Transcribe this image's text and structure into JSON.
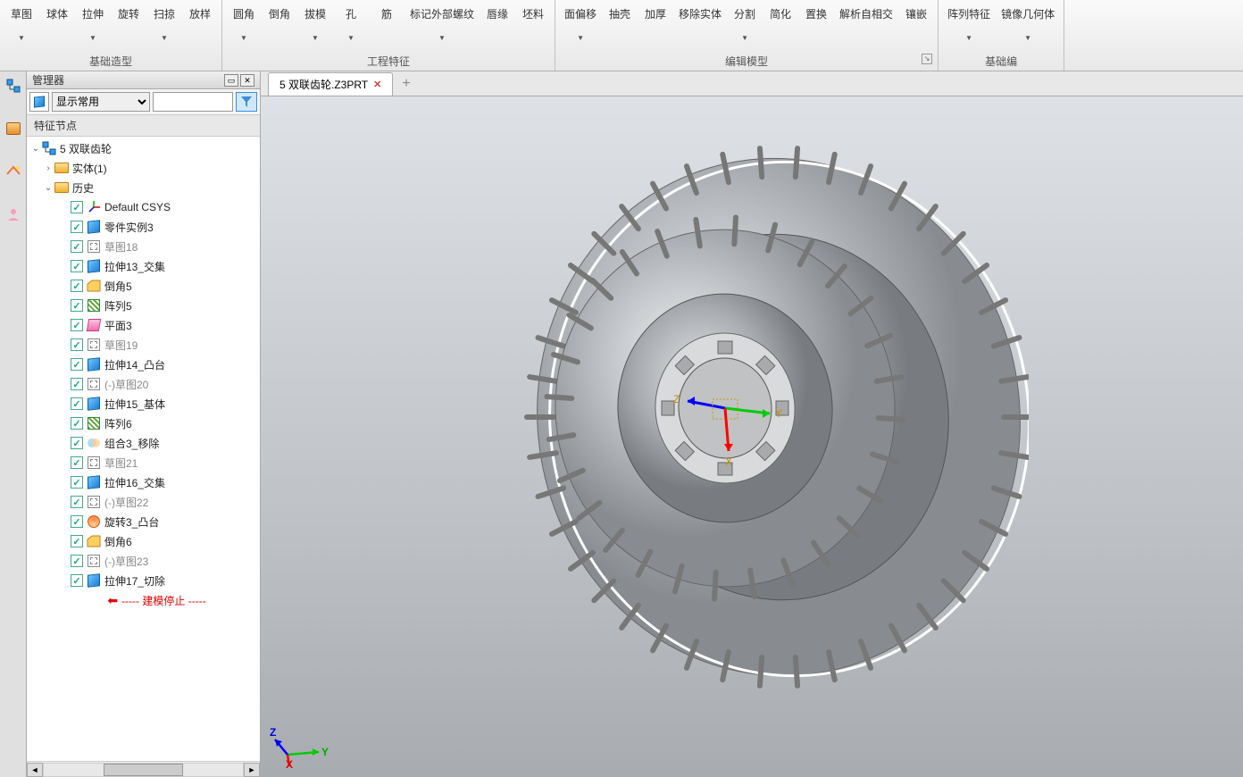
{
  "ribbon": {
    "groups": [
      {
        "label": "基础造型",
        "launcher": false,
        "items": [
          {
            "label": "草图",
            "dropdown": true
          },
          {
            "label": "球体",
            "dropdown": false
          },
          {
            "label": "拉伸",
            "dropdown": true
          },
          {
            "label": "旋转",
            "dropdown": false
          },
          {
            "label": "扫掠",
            "dropdown": true
          },
          {
            "label": "放样",
            "dropdown": false
          }
        ]
      },
      {
        "label": "工程特征",
        "launcher": false,
        "items": [
          {
            "label": "圆角",
            "dropdown": true
          },
          {
            "label": "倒角",
            "dropdown": false
          },
          {
            "label": "拔模",
            "dropdown": true
          },
          {
            "label": "孔",
            "dropdown": true
          },
          {
            "label": "筋",
            "dropdown": false
          },
          {
            "label": "标记外部螺纹",
            "dropdown": true
          },
          {
            "label": "唇缘",
            "dropdown": false
          },
          {
            "label": "坯料",
            "dropdown": false
          }
        ]
      },
      {
        "label": "编辑模型",
        "launcher": true,
        "items": [
          {
            "label": "面偏移",
            "dropdown": true
          },
          {
            "label": "抽壳",
            "dropdown": false
          },
          {
            "label": "加厚",
            "dropdown": false
          },
          {
            "label": "移除实体",
            "dropdown": false
          },
          {
            "label": "分割",
            "dropdown": true
          },
          {
            "label": "简化",
            "dropdown": false
          },
          {
            "label": "置换",
            "dropdown": false
          },
          {
            "label": "解析自相交",
            "dropdown": false
          },
          {
            "label": "镶嵌",
            "dropdown": false
          }
        ]
      },
      {
        "label": "基础编",
        "launcher": false,
        "items": [
          {
            "label": "阵列特征",
            "dropdown": true
          },
          {
            "label": "镜像几何体",
            "dropdown": true
          }
        ]
      }
    ]
  },
  "panel": {
    "title": "管理器",
    "filter_dropdown": "显示常用",
    "tree_header": "特征节点"
  },
  "tab": {
    "name": "5 双联齿轮.Z3PRT"
  },
  "tree": {
    "root": "5 双联齿轮",
    "solid": "实体(1)",
    "history": "历史",
    "nodes": [
      {
        "label": "Default CSYS",
        "type": "csys",
        "muted": false
      },
      {
        "label": "零件实例3",
        "type": "instance",
        "muted": false
      },
      {
        "label": "草图18",
        "type": "sketch",
        "muted": true
      },
      {
        "label": "拉伸13_交集",
        "type": "extrude",
        "muted": false
      },
      {
        "label": "倒角5",
        "type": "chamfer",
        "muted": false
      },
      {
        "label": "阵列5",
        "type": "pattern",
        "muted": false
      },
      {
        "label": "平面3",
        "type": "plane",
        "muted": false
      },
      {
        "label": "草图19",
        "type": "sketch",
        "muted": true
      },
      {
        "label": "拉伸14_凸台",
        "type": "extrude",
        "muted": false
      },
      {
        "label": "(-)草图20",
        "type": "sketch",
        "muted": true
      },
      {
        "label": "拉伸15_基体",
        "type": "extrude",
        "muted": false
      },
      {
        "label": "阵列6",
        "type": "pattern",
        "muted": false
      },
      {
        "label": "组合3_移除",
        "type": "combine",
        "muted": false
      },
      {
        "label": "草图21",
        "type": "sketch",
        "muted": true
      },
      {
        "label": "拉伸16_交集",
        "type": "extrude",
        "muted": false
      },
      {
        "label": "(-)草图22",
        "type": "sketch",
        "muted": true
      },
      {
        "label": "旋转3_凸台",
        "type": "revolve",
        "muted": false
      },
      {
        "label": "倒角6",
        "type": "chamfer",
        "muted": false
      },
      {
        "label": "(-)草图23",
        "type": "sketch",
        "muted": true
      },
      {
        "label": "拉伸17_切除",
        "type": "extrude",
        "muted": false
      }
    ],
    "stop": "----- 建模停止 -----"
  },
  "axis": {
    "x": "X",
    "y": "Y",
    "z": "Z"
  },
  "center_axis": {
    "x": "X",
    "y": "Y",
    "z": "Z"
  }
}
